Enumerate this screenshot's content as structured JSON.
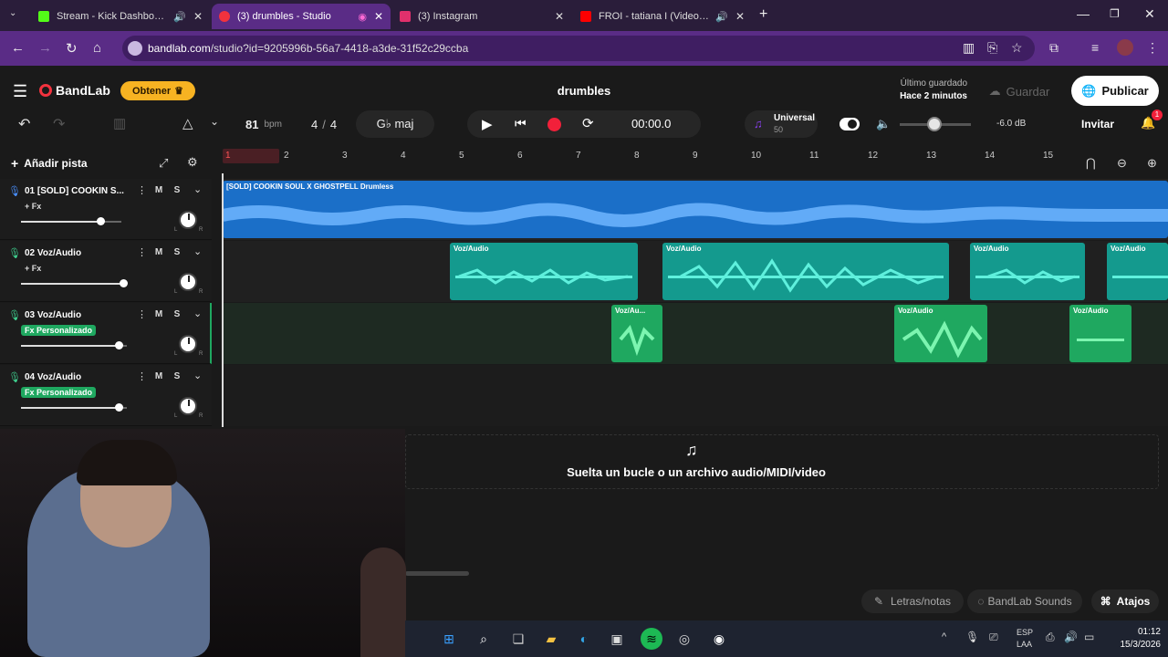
{
  "browser": {
    "tabs": [
      {
        "title": "Stream - Kick Dashboard",
        "color": "#53fc18"
      },
      {
        "title": "(3) drumbles - Studio",
        "color": "#f2323e"
      },
      {
        "title": "(3) Instagram",
        "color": "#e1306c"
      },
      {
        "title": "FROI - tatiana I (Video Ofici",
        "color": "#ff0000"
      }
    ],
    "url_host": "bandlab.com",
    "url_path": "/studio?id=9205996b-56a7-4418-a3de-31f52c29ccba"
  },
  "app": {
    "logo": "BandLab",
    "obtener": "Obtener",
    "project_title": "drumbles",
    "last_saved_label": "Último guardado",
    "last_saved_time": "Hace 2 minutos",
    "save_label": "Guardar",
    "publish_label": "Publicar",
    "bpm_value": "81",
    "bpm_unit": "bpm",
    "time_sig_num": "4",
    "time_sig_sep": "/",
    "time_sig_den": "4",
    "key": "G♭ maj",
    "time_display": "00:00.0",
    "instrument_name": "Universal",
    "instrument_num": "50",
    "master_db": "-6.0 dB",
    "invite_label": "Invitar",
    "notif_count": "1",
    "add_track_label": "Añadir pista",
    "drop_text": "Suelta un bucle o un archivo audio/MIDI/video",
    "bottom": {
      "lyrics": "Letras/notas",
      "sounds": "BandLab Sounds",
      "shortcuts": "Atajos"
    },
    "ruler": [
      "1",
      "2",
      "3",
      "4",
      "5",
      "6",
      "7",
      "8",
      "9",
      "10",
      "11",
      "12",
      "13",
      "14",
      "15"
    ],
    "mute_label": "M",
    "solo_label": "S",
    "pan_l": "L",
    "pan_r": "R",
    "tracks": [
      {
        "num": "01",
        "name": "[SOLD] COOKIN S...",
        "fx": "+ Fx",
        "fx_custom": false,
        "volume": 0.9
      },
      {
        "num": "02",
        "name": "Voz/Audio",
        "fx": "+ Fx",
        "fx_custom": false,
        "volume": 0.96
      },
      {
        "num": "03",
        "name": "Voz/Audio",
        "fx": "Fx Personalizado",
        "fx_custom": true,
        "volume": 0.92
      },
      {
        "num": "04",
        "name": "Voz/Audio",
        "fx": "Fx Personalizado",
        "fx_custom": true,
        "volume": 0.92
      }
    ],
    "clips": {
      "beat": "[SOLD] COOKIN SOUL X GHOSTPELL Drumless",
      "voz": "Voz/Audio",
      "voz_short": "Voz/Au..."
    }
  },
  "taskbar": {
    "lang1": "ESP",
    "lang2": "LAA",
    "time": "01:12",
    "date": "15/3/2026"
  }
}
